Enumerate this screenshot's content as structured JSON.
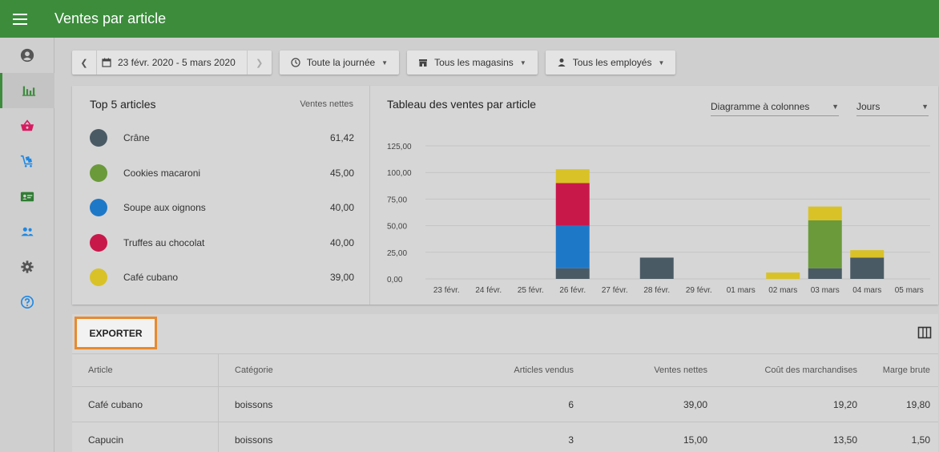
{
  "app": {
    "title": "Ventes par article",
    "menu_icon": "hamburger-menu-icon"
  },
  "sidebar": {
    "items": [
      {
        "icon": "account-circle-icon",
        "color": "#555555",
        "active": false
      },
      {
        "icon": "bar-chart-icon",
        "color": "#3c8c3c",
        "active": true
      },
      {
        "icon": "basket-icon",
        "color": "#d81b60",
        "active": false
      },
      {
        "icon": "items-cart-icon",
        "color": "#1e88e5",
        "active": false
      },
      {
        "icon": "customer-card-icon",
        "color": "#2e7d32",
        "active": false
      },
      {
        "icon": "employees-icon",
        "color": "#1e88e5",
        "active": false
      },
      {
        "icon": "settings-gear-icon",
        "color": "#555555",
        "active": false
      },
      {
        "icon": "help-circle-icon",
        "color": "#1e88e5",
        "active": false
      }
    ]
  },
  "filters": {
    "date_range": "23 févr. 2020 - 5 mars 2020",
    "time": "Toute la journée",
    "stores": "Tous les magasins",
    "employees": "Tous les employés"
  },
  "top5": {
    "title": "Top 5 articles",
    "column": "Ventes nettes",
    "items": [
      {
        "name": "Crâne",
        "value": "61,42",
        "color": "#4a5a65"
      },
      {
        "name": "Cookies macaroni",
        "value": "45,00",
        "color": "#6a9a3a"
      },
      {
        "name": "Soupe aux oignons",
        "value": "40,00",
        "color": "#1e78c8"
      },
      {
        "name": "Truffes au chocolat",
        "value": "40,00",
        "color": "#c8184a"
      },
      {
        "name": "Café cubano",
        "value": "39,00",
        "color": "#d9c228"
      }
    ]
  },
  "chart": {
    "title": "Tableau des ventes par article",
    "type_select": "Diagramme à colonnes",
    "period_select": "Jours"
  },
  "chart_data": {
    "type": "bar",
    "stacked": true,
    "categories": [
      "23 févr.",
      "24 févr.",
      "25 févr.",
      "26 févr.",
      "27 févr.",
      "28 févr.",
      "29 févr.",
      "01 mars",
      "02 mars",
      "03 mars",
      "04 mars",
      "05 mars"
    ],
    "series": [
      {
        "name": "Crâne",
        "color": "#4a5a65",
        "values": [
          0,
          0,
          0,
          10,
          0,
          20,
          0,
          0,
          0,
          10,
          20,
          0
        ]
      },
      {
        "name": "Cookies macaroni",
        "color": "#6a9a3a",
        "values": [
          0,
          0,
          0,
          0,
          0,
          0,
          0,
          0,
          0,
          45,
          0,
          0
        ]
      },
      {
        "name": "Soupe aux oignons",
        "color": "#1e78c8",
        "values": [
          0,
          0,
          0,
          40,
          0,
          0,
          0,
          0,
          0,
          0,
          0,
          0
        ]
      },
      {
        "name": "Truffes au chocolat",
        "color": "#c8184a",
        "values": [
          0,
          0,
          0,
          40,
          0,
          0,
          0,
          0,
          0,
          0,
          0,
          0
        ]
      },
      {
        "name": "Café cubano",
        "color": "#d9c228",
        "values": [
          0,
          0,
          0,
          13,
          0,
          0,
          0,
          0,
          6,
          13,
          7,
          0
        ]
      }
    ],
    "y_ticks": [
      "0,00",
      "25,00",
      "50,00",
      "75,00",
      "100,00",
      "125,00"
    ],
    "ylim": [
      0,
      125
    ],
    "grid": true,
    "legend": "none"
  },
  "export": {
    "label": "EXPORTER",
    "columns_icon": "columns-icon"
  },
  "table": {
    "headers": [
      "Article",
      "Catégorie",
      "Articles vendus",
      "Ventes nettes",
      "Coût des marchandises",
      "Marge brute"
    ],
    "rows": [
      [
        "Café cubano",
        "boissons",
        "6",
        "39,00",
        "19,20",
        "19,80"
      ],
      [
        "Capucin",
        "boissons",
        "3",
        "15,00",
        "13,50",
        "1,50"
      ]
    ]
  }
}
